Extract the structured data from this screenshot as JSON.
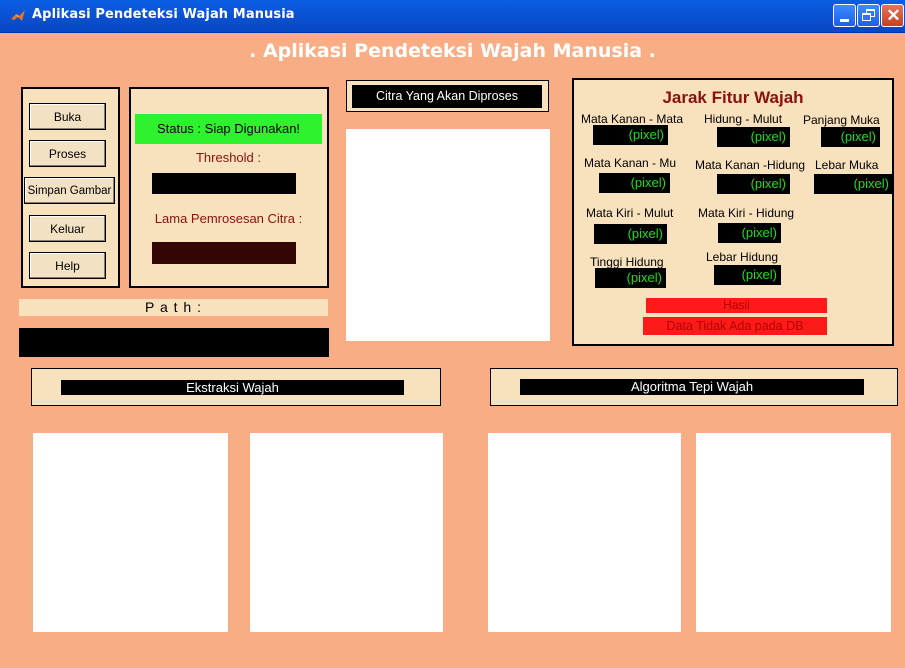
{
  "window": {
    "title": "Aplikasi Pendeteksi Wajah Manusia"
  },
  "header": {
    "title": ". Aplikasi Pendeteksi Wajah Manusia ."
  },
  "buttons": {
    "buka": "Buka",
    "proses": "Proses",
    "simpan": "Simpan Gambar",
    "keluar": "Keluar",
    "help": "Help"
  },
  "status": {
    "text": "Status : Siap Digunakan!",
    "threshold_label": "Threshold :",
    "lama_label": "Lama Pemrosesan Citra :"
  },
  "path": {
    "label": "P a t h :"
  },
  "citra": {
    "label": "Citra Yang Akan Diproses"
  },
  "jarak": {
    "title": "Jarak Fitur Wajah",
    "labels": {
      "mata_kanan_mata": "Mata Kanan - Mata",
      "hidung_mulut": "Hidung - Mulut",
      "panjang_muka": "Panjang Muka",
      "mata_kanan_mu": "Mata Kanan - Mu",
      "mata_kanan_hidung": "Mata Kanan -Hidung",
      "lebar_muka": "Lebar Muka",
      "mata_kiri_mulut": "Mata Kiri - Mulut",
      "mata_kiri_hidung": "Mata Kiri - Hidung",
      "tinggi_hidung": "Tinggi Hidung",
      "lebar_hidung": "Lebar  Hidung"
    },
    "unit": "(pixel)",
    "hasil_label": "Hasil",
    "result_text": "Data Tidak Ada pada DB"
  },
  "sections": {
    "ekstraksi": "Ekstraksi Wajah",
    "algoritma": "Algoritma Tepi Wajah"
  },
  "colors": {
    "background": "#f9ad85",
    "panel": "#f8e1bd",
    "status_green": "#2ef22e",
    "threshold_red": "#8b1010",
    "value_green": "#18e018",
    "result_red": "#ff1a1a"
  }
}
